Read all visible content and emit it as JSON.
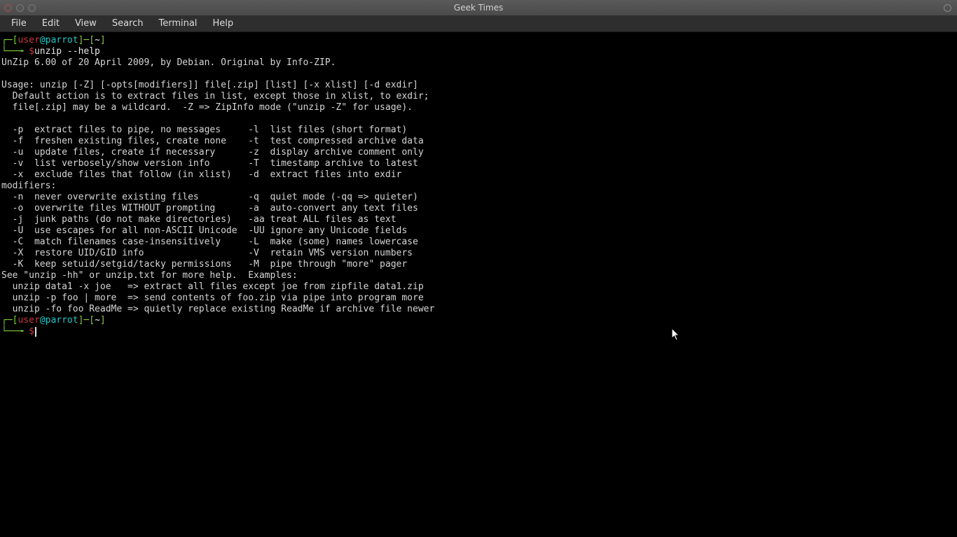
{
  "window": {
    "title": "Geek Times"
  },
  "menubar": {
    "items": [
      "File",
      "Edit",
      "View",
      "Search",
      "Terminal",
      "Help"
    ]
  },
  "prompt1": {
    "openBracket": "┌─[",
    "user": "user",
    "at": "@",
    "host": "parrot",
    "closeBracket": "]─[",
    "path": "~",
    "end": "]",
    "line2prefix": "└──╼ ",
    "dollar": "$",
    "command": "unzip --help"
  },
  "output": [
    "UnZip 6.00 of 20 April 2009, by Debian. Original by Info-ZIP.",
    "",
    "Usage: unzip [-Z] [-opts[modifiers]] file[.zip] [list] [-x xlist] [-d exdir]",
    "  Default action is to extract files in list, except those in xlist, to exdir;",
    "  file[.zip] may be a wildcard.  -Z => ZipInfo mode (\"unzip -Z\" for usage).",
    "",
    "  -p  extract files to pipe, no messages     -l  list files (short format)",
    "  -f  freshen existing files, create none    -t  test compressed archive data",
    "  -u  update files, create if necessary      -z  display archive comment only",
    "  -v  list verbosely/show version info       -T  timestamp archive to latest",
    "  -x  exclude files that follow (in xlist)   -d  extract files into exdir",
    "modifiers:",
    "  -n  never overwrite existing files         -q  quiet mode (-qq => quieter)",
    "  -o  overwrite files WITHOUT prompting      -a  auto-convert any text files",
    "  -j  junk paths (do not make directories)   -aa treat ALL files as text",
    "  -U  use escapes for all non-ASCII Unicode  -UU ignore any Unicode fields",
    "  -C  match filenames case-insensitively     -L  make (some) names lowercase",
    "  -X  restore UID/GID info                   -V  retain VMS version numbers",
    "  -K  keep setuid/setgid/tacky permissions   -M  pipe through \"more\" pager",
    "See \"unzip -hh\" or unzip.txt for more help.  Examples:",
    "  unzip data1 -x joe   => extract all files except joe from zipfile data1.zip",
    "  unzip -p foo | more  => send contents of foo.zip via pipe into program more",
    "  unzip -fo foo ReadMe => quietly replace existing ReadMe if archive file newer"
  ],
  "prompt2": {
    "openBracket": "┌─[",
    "user": "user",
    "at": "@",
    "host": "parrot",
    "closeBracket": "]─[",
    "path": "~",
    "end": "]",
    "line2prefix": "└──╼ ",
    "dollar": "$"
  }
}
